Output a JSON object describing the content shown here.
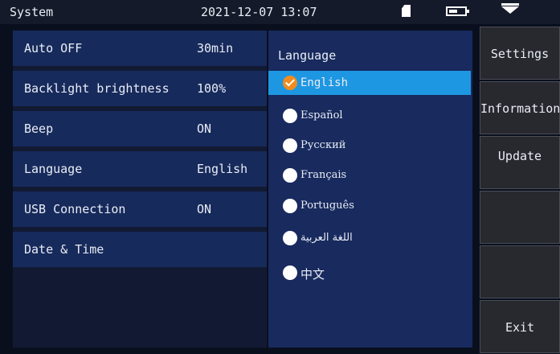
{
  "header": {
    "title": "System",
    "datetime": "2021-12-07 13:07",
    "battery_level": 0.7,
    "icons": [
      "sd-card-icon",
      "battery-icon",
      "dropdown-icon"
    ]
  },
  "settings": [
    {
      "label": "Auto OFF",
      "value": "30min"
    },
    {
      "label": "Backlight brightness",
      "value": "100%"
    },
    {
      "label": "Beep",
      "value": "ON"
    },
    {
      "label": "Language",
      "value": "English"
    },
    {
      "label": "USB Connection",
      "value": "ON"
    },
    {
      "label": "Date & Time",
      "value": ""
    }
  ],
  "language_menu": {
    "title": "Language",
    "selected": "English",
    "options": [
      "English",
      "Español",
      "Русский",
      "Français",
      "Português",
      "اللغة العربية",
      "中文"
    ]
  },
  "side_buttons": [
    "Settings",
    "Information",
    "Update",
    "",
    "",
    "Exit"
  ],
  "colors": {
    "background": "#0a0f1e",
    "topbar": "#151a2a",
    "row": "#172a5c",
    "lang_panel": "#182a5e",
    "selected": "#1e97e2",
    "check": "#f08c1e",
    "side_button": "#27292f"
  }
}
